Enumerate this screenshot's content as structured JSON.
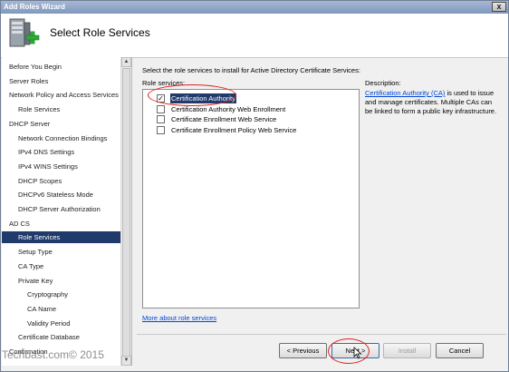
{
  "window": {
    "title": "Add Roles Wizard",
    "close_glyph": "x"
  },
  "header": {
    "title": "Select Role Services",
    "icon": "server-add-icon"
  },
  "sidebar": {
    "items": [
      {
        "label": "Before You Begin",
        "level": 0
      },
      {
        "label": "Server Roles",
        "level": 0
      },
      {
        "label": "Network Policy and Access Services",
        "level": 0
      },
      {
        "label": "Role Services",
        "level": 1
      },
      {
        "label": "DHCP Server",
        "level": 0
      },
      {
        "label": "Network Connection Bindings",
        "level": 1
      },
      {
        "label": "IPv4 DNS Settings",
        "level": 1
      },
      {
        "label": "IPv4 WINS Settings",
        "level": 1
      },
      {
        "label": "DHCP Scopes",
        "level": 1
      },
      {
        "label": "DHCPv6 Stateless Mode",
        "level": 1
      },
      {
        "label": "DHCP Server Authorization",
        "level": 1
      },
      {
        "label": "AD CS",
        "level": 0
      },
      {
        "label": "Role Services",
        "level": 1,
        "selected": true
      },
      {
        "label": "Setup Type",
        "level": 1
      },
      {
        "label": "CA Type",
        "level": 1
      },
      {
        "label": "Private Key",
        "level": 1
      },
      {
        "label": "Cryptography",
        "level": 2
      },
      {
        "label": "CA Name",
        "level": 2
      },
      {
        "label": "Validity Period",
        "level": 2
      },
      {
        "label": "Certificate Database",
        "level": 1
      },
      {
        "label": "Confirmation",
        "level": 0
      }
    ]
  },
  "main": {
    "instructions": "Select the role services to install for Active Directory Certificate Services:",
    "role_services_label": "Role services:",
    "role_services": [
      {
        "label": "Certification Authority",
        "checked": true,
        "selected": true
      },
      {
        "label": "Certification Authority Web Enrollment",
        "checked": false
      },
      {
        "label": "Certificate Enrollment Web Service",
        "checked": false
      },
      {
        "label": "Certificate Enrollment Policy Web Service",
        "checked": false
      }
    ],
    "description_label": "Description:",
    "description_link": "Certification Authority (CA)",
    "description_text": " is used to issue and manage certificates. Multiple CAs can be linked to form a public key infrastructure.",
    "more_link": "More about role services"
  },
  "buttons": {
    "previous": "< Previous",
    "next": "Next >",
    "install": "Install",
    "cancel": "Cancel"
  },
  "watermark": "Techbast.com© 2015",
  "colors": {
    "selection": "#1f3a6b",
    "link": "#0046d5",
    "annotation": "#e02020"
  }
}
